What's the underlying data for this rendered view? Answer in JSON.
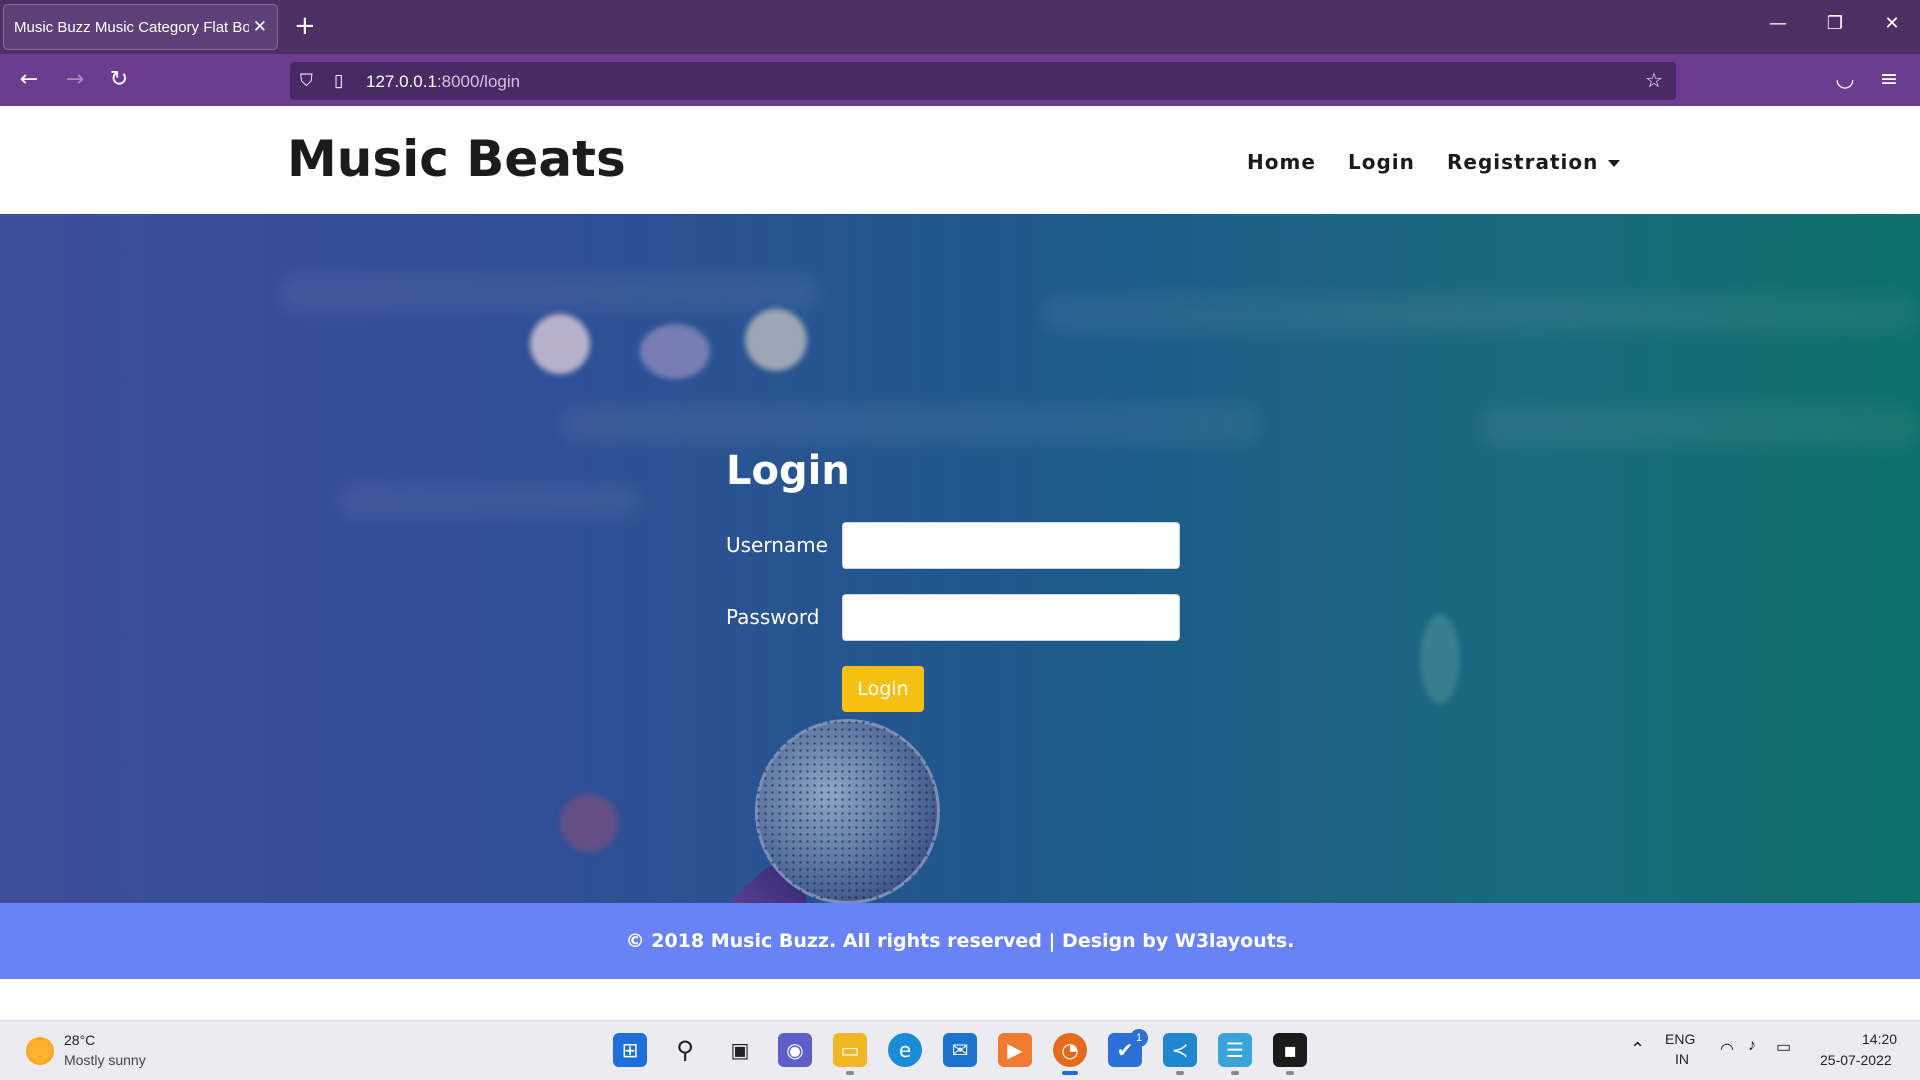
{
  "browser": {
    "tab_title": "Music Buzz Music Category Flat Boo",
    "tab_close": "✕",
    "new_tab": "+",
    "url_host": "127.0.0.1",
    "url_path": ":8000/login",
    "controls": {
      "minimize": "—",
      "restore": "❐",
      "close": "✕"
    },
    "nav": {
      "back": "←",
      "forward": "→",
      "reload": "↻"
    },
    "icons": {
      "shield": "⛉",
      "page": "▯",
      "star": "☆",
      "pocket": "◡",
      "menu": "≡"
    }
  },
  "site": {
    "brand": "Music Beats",
    "nav": {
      "home": "Home",
      "login": "Login",
      "registration": "Registration"
    }
  },
  "login": {
    "title": "Login",
    "username_label": "Username",
    "password_label": "Password",
    "username_value": "",
    "password_value": "",
    "button": "Login"
  },
  "footer": {
    "text": "© 2018 Music Buzz. All rights reserved | Design by W3layouts."
  },
  "taskbar": {
    "weather_temp": "28°C",
    "weather_desc": "Mostly sunny",
    "badge_count": "1",
    "lang_1": "ENG",
    "lang_2": "IN",
    "time": "14:20",
    "date": "25-07-2022",
    "apps": [
      "start",
      "search",
      "task-view",
      "chat",
      "file-explorer",
      "edge",
      "mail",
      "media-player",
      "firefox",
      "todo",
      "vscode",
      "notepad",
      "terminal"
    ]
  },
  "colors": {
    "chrome_tabbar": "#4c2f63",
    "chrome_navbar": "#6b3c8f",
    "login_button": "#f5c012",
    "footer": "#6983f6"
  }
}
